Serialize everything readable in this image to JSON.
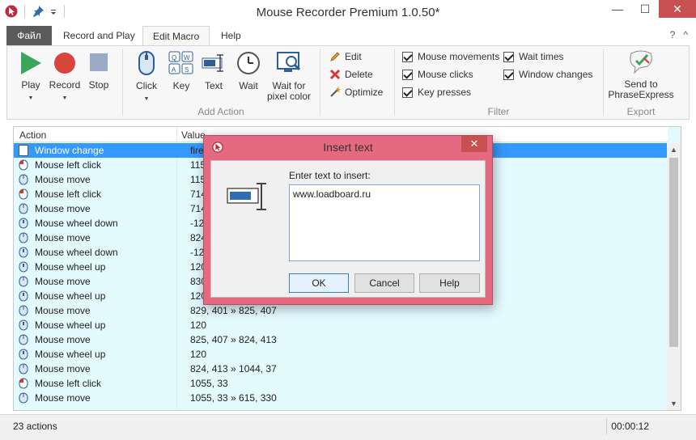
{
  "window": {
    "title": "Mouse Recorder Premium 1.0.50*",
    "minimize": "—",
    "maximize": "☐",
    "close": "✕"
  },
  "tabs": [
    {
      "label": "Файл"
    },
    {
      "label": "Record and Play"
    },
    {
      "label": "Edit Macro"
    },
    {
      "label": "Help"
    }
  ],
  "ribbon_right": {
    "help": "?",
    "collapse": "^"
  },
  "ribbon": {
    "play": "Play",
    "record": "Record",
    "stop": "Stop",
    "click": "Click",
    "key": "Key",
    "text": "Text",
    "wait": "Wait",
    "wait_pixel_line1": "Wait for",
    "wait_pixel_line2": "pixel color",
    "add_action_group": "Add Action",
    "edit": "Edit",
    "delete": "Delete",
    "optimize": "Optimize",
    "filter": {
      "mouse_movements": "Mouse movements",
      "mouse_clicks": "Mouse clicks",
      "key_presses": "Key presses",
      "wait_times": "Wait times",
      "window_changes": "Window changes"
    },
    "filter_group": "Filter",
    "send_line1": "Send to",
    "send_line2": "PhraseExpress",
    "export_group": "Export"
  },
  "list": {
    "col_action": "Action",
    "col_value": "Value",
    "rows": [
      {
        "action": "Window change",
        "value": "firef"
      },
      {
        "action": "Mouse left click",
        "value": "115"
      },
      {
        "action": "Mouse move",
        "value": "115"
      },
      {
        "action": "Mouse left click",
        "value": "714"
      },
      {
        "action": "Mouse move",
        "value": "714"
      },
      {
        "action": "Mouse wheel down",
        "value": "-120"
      },
      {
        "action": "Mouse move",
        "value": "824"
      },
      {
        "action": "Mouse wheel down",
        "value": "-120"
      },
      {
        "action": "Mouse wheel up",
        "value": "120"
      },
      {
        "action": "Mouse move",
        "value": "830"
      },
      {
        "action": "Mouse wheel up",
        "value": "120"
      },
      {
        "action": "Mouse move",
        "value": "829, 401 » 825, 407"
      },
      {
        "action": "Mouse wheel up",
        "value": "120"
      },
      {
        "action": "Mouse move",
        "value": "825, 407 » 824, 413"
      },
      {
        "action": "Mouse wheel up",
        "value": "120"
      },
      {
        "action": "Mouse move",
        "value": "824, 413 » 1044, 37"
      },
      {
        "action": "Mouse left click",
        "value": "1055, 33"
      },
      {
        "action": "Mouse move",
        "value": "1055, 33 » 615, 330"
      }
    ]
  },
  "status": {
    "count": "23 actions",
    "time": "00:00:12"
  },
  "dialog": {
    "title": "Insert text",
    "label": "Enter text to insert:",
    "text": "www.loadboard.ru",
    "ok": "OK",
    "cancel": "Cancel",
    "help": "Help"
  }
}
